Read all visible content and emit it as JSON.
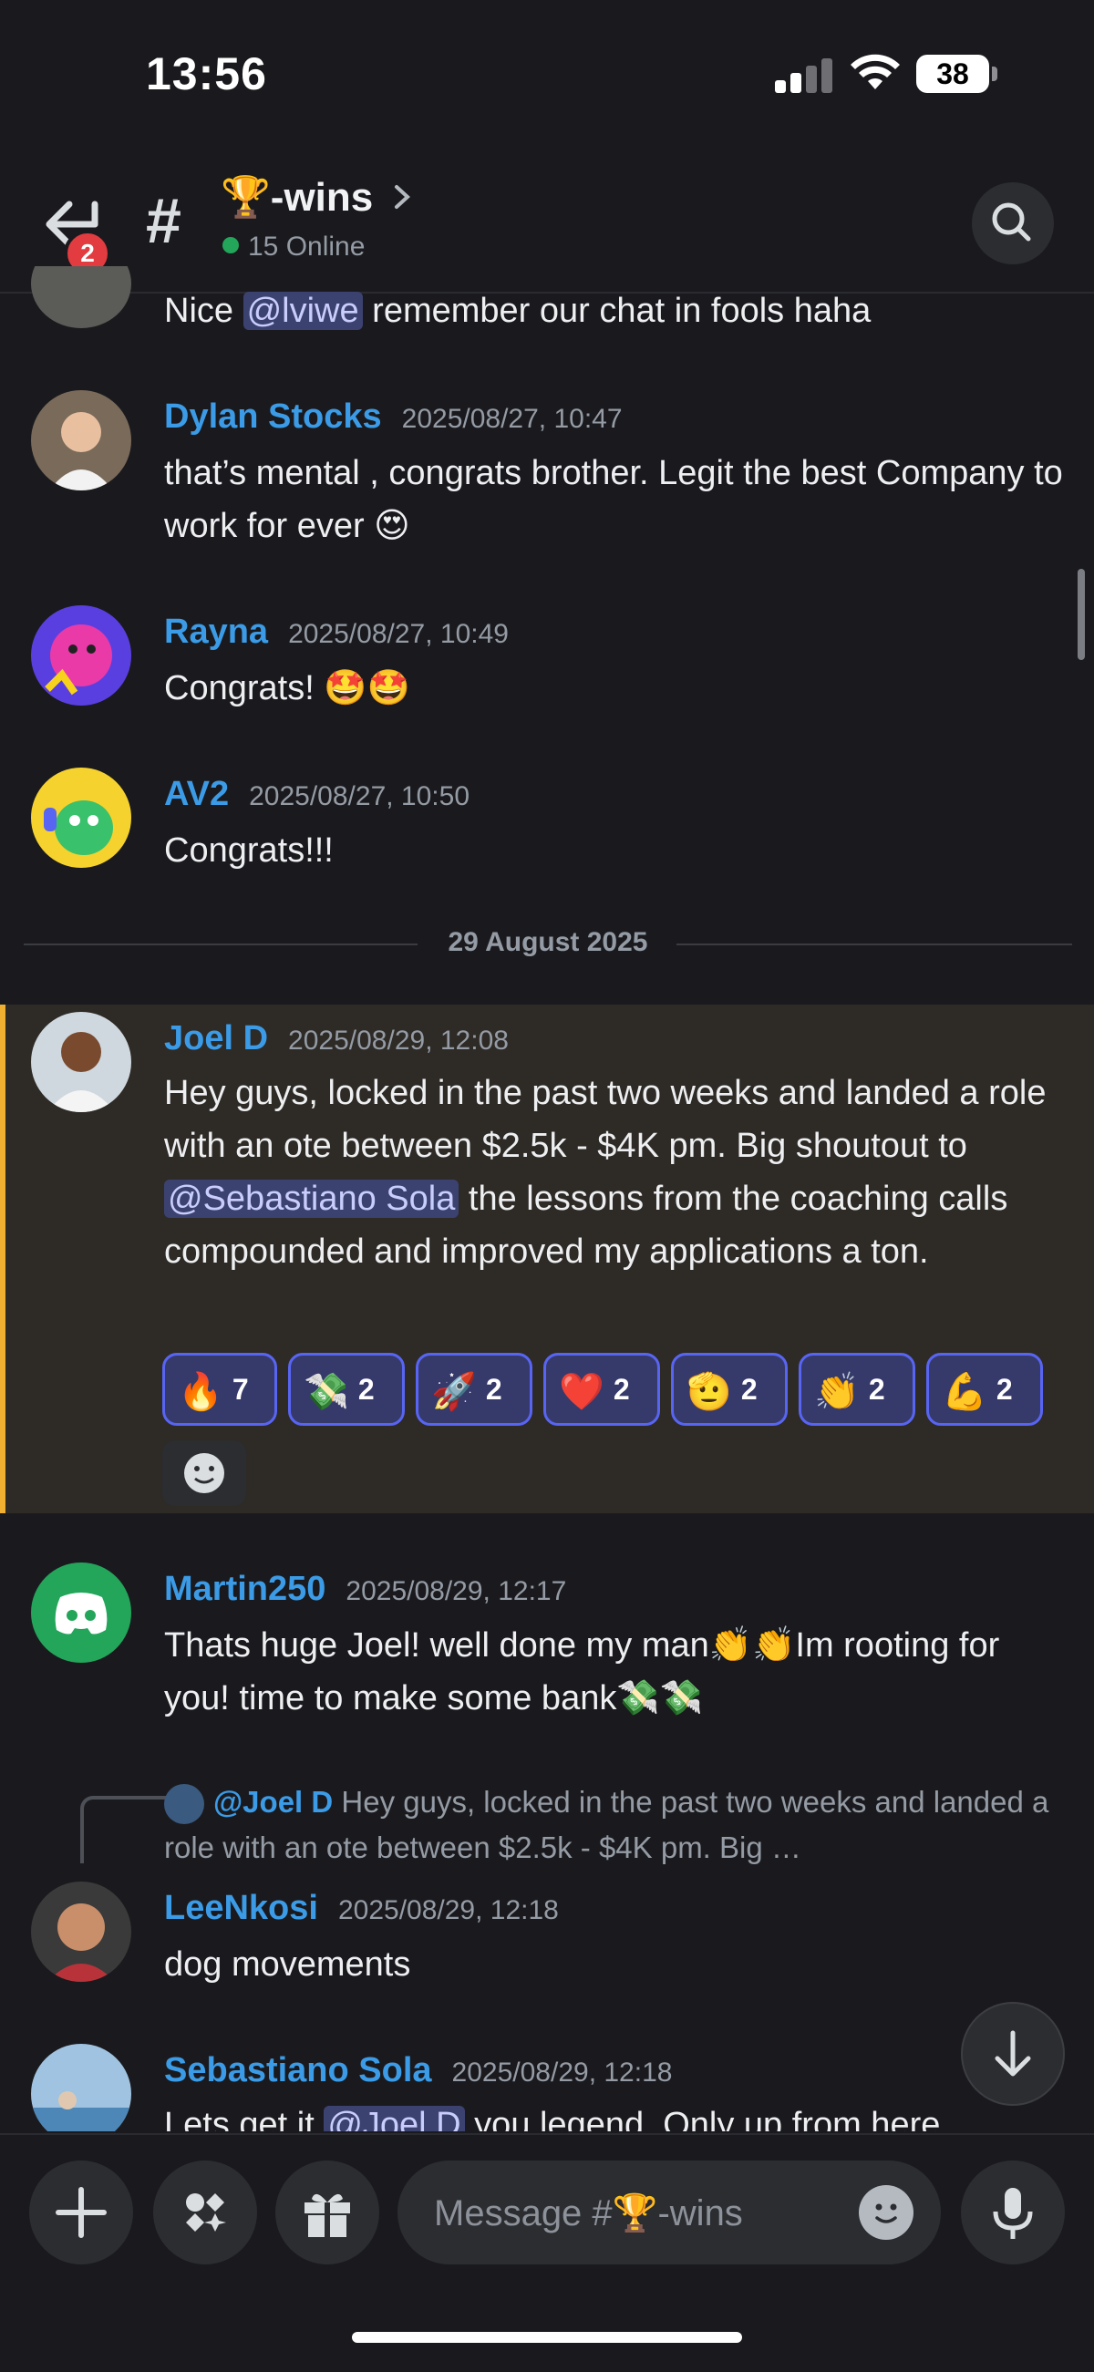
{
  "status_bar": {
    "time": "13:56",
    "battery": "38"
  },
  "header": {
    "back_badge": "2",
    "channel_name": "🏆-wins",
    "online": "15 Online"
  },
  "messages": [
    {
      "content_parts": [
        "Nice ",
        "@lviwe",
        " remember our chat in fools haha"
      ]
    },
    {
      "author": "Dylan Stocks",
      "time": "2025/08/27, 10:47",
      "content": "that’s mental , congrats brother. Legit the best Company to work for ever 😍"
    },
    {
      "author": "Rayna",
      "time": "2025/08/27, 10:49",
      "content": "Congrats! 🤩🤩"
    },
    {
      "author": "AV2",
      "time": "2025/08/27, 10:50",
      "content": "Congrats!!!"
    },
    {
      "author": "Joel D",
      "time": "2025/08/29, 12:08",
      "content_parts": [
        "Hey guys, locked in the past two weeks and landed a role with an ote between $2.5k - $4K pm. Big shoutout to ",
        "@Sebastiano Sola",
        " the lessons from the coaching calls compounded and improved my applications a ton."
      ]
    },
    {
      "author": "Martin250",
      "time": "2025/08/29, 12:17",
      "content": "Thats huge Joel! well done my man👏👏Im rooting for you! time to make some bank💸💸"
    },
    {
      "author": "LeeNkosi",
      "time": "2025/08/29, 12:18",
      "content": "dog movements"
    },
    {
      "author": "Sebastiano Sola",
      "time": "2025/08/29, 12:18",
      "content_parts": [
        "Lets get it ",
        "@Joel D",
        " you legend. Only up from here"
      ]
    }
  ],
  "date_separator": "29 August 2025",
  "reactions": [
    {
      "emoji": "🔥",
      "count": "7"
    },
    {
      "emoji": "💸",
      "count": "2"
    },
    {
      "emoji": "🚀",
      "count": "2"
    },
    {
      "emoji": "❤️",
      "count": "2"
    },
    {
      "emoji": "🫡",
      "count": "2"
    },
    {
      "emoji": "👏",
      "count": "2"
    },
    {
      "emoji": "💪",
      "count": "2"
    }
  ],
  "reply": {
    "mention": "@Joel D",
    "preview": "Hey guys, locked in the past two weeks and landed a role with an ote between $2.5k - $4K pm. Big …"
  },
  "composer": {
    "placeholder": "Message #🏆-wins"
  },
  "icons": [
    "back-arrow-icon",
    "hash-icon",
    "chevron-right-icon",
    "search-icon",
    "plus-icon",
    "apps-icon",
    "gift-icon",
    "emoji-icon",
    "microphone-icon",
    "arrow-down-icon"
  ],
  "colors": {
    "background": "#1a1a1e",
    "accent": "#5865f2",
    "author": "#3b9be6",
    "highlight": "#f0b132",
    "online": "#23a55a"
  }
}
